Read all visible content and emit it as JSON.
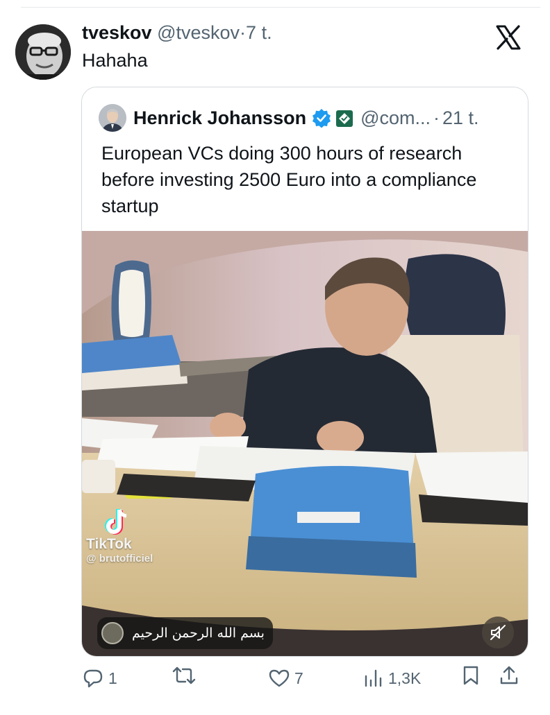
{
  "tweet": {
    "author_name": "tveskov",
    "author_handle": "@tveskov",
    "separator": "·",
    "time": "7 t.",
    "text": "Hahaha"
  },
  "quoted_tweet": {
    "author_name": "Henrick Johansson",
    "author_handle": "@com...",
    "separator": "·",
    "time": "21 t.",
    "text": "European VCs doing 300 hours of research before investing 2500 Euro into a compliance startup",
    "media": {
      "watermark_brand": "TikTok",
      "watermark_handle": "@ brutofficiel",
      "sound_label": "بسم الله الرحمن الرحيم"
    }
  },
  "actions": {
    "replies": "1",
    "reposts": "",
    "likes": "7",
    "views": "1,3K"
  },
  "icons": {
    "x_logo": "x-logo-icon",
    "verified": "verified-badge-icon",
    "affiliation": "affiliation-badge-icon",
    "reply": "reply-icon",
    "repost": "repost-icon",
    "like": "heart-icon",
    "views": "views-chart-icon",
    "bookmark": "bookmark-icon",
    "share": "share-icon",
    "mute": "volume-muted-icon",
    "tiktok": "tiktok-logo-icon"
  },
  "colors": {
    "text_primary": "#0f1419",
    "text_muted": "#536471",
    "verified_blue": "#1d9bf0",
    "affiliation_green": "#1c6b4f",
    "card_border": "#d4d9dd"
  }
}
